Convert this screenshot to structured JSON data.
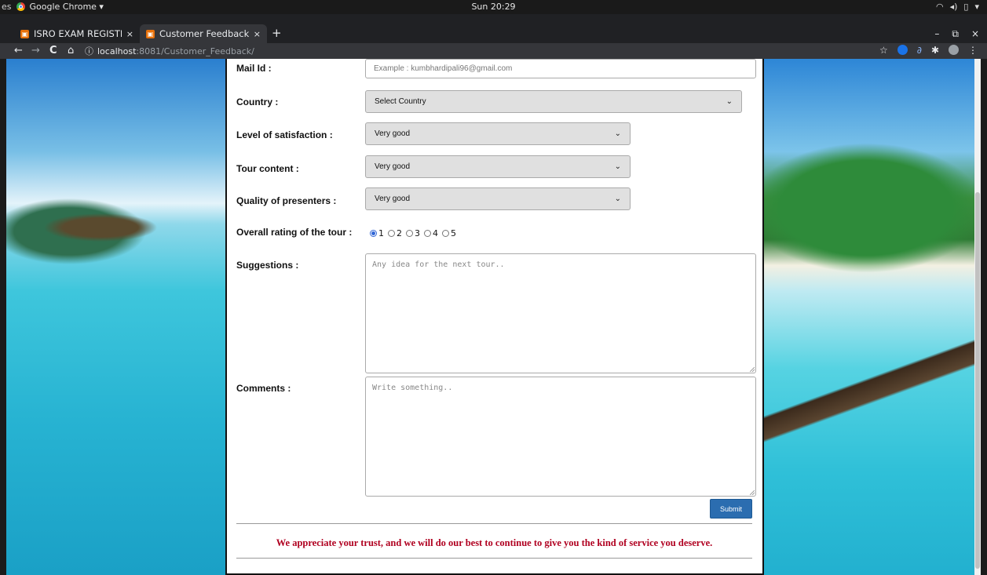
{
  "os_bar": {
    "activities": "es",
    "app_menu": "Google Chrome ▾",
    "clock": "Sun 20:29",
    "tray": [
      "wifi-icon",
      "volume-icon",
      "battery-icon",
      "menu-arrow-icon"
    ]
  },
  "browser": {
    "tabs": [
      {
        "title": "ISRO EXAM REGISTRATIO",
        "close": "×",
        "active": false
      },
      {
        "title": "Customer Feedback Form",
        "close": "×",
        "active": true
      }
    ],
    "new_tab": "+",
    "window_controls": {
      "minimize": "–",
      "restore": "⧉",
      "close": "×"
    },
    "nav": {
      "back": "←",
      "forward": "→",
      "reload": "C",
      "home": "⌂"
    },
    "url": {
      "host": "localhost",
      "path": ":8081/Customer_Feedback/"
    },
    "toolbar_icons": [
      "star-icon",
      "extension-icon",
      "link-icon",
      "puzzle-icon",
      "avatar-icon",
      "menu-icon"
    ]
  },
  "form": {
    "mail": {
      "label": "Mail Id :",
      "placeholder": "Example : kumbhardipali96@gmail.com"
    },
    "country": {
      "label": "Country :",
      "value": "Select Country"
    },
    "satisfaction": {
      "label": "Level of satisfaction :",
      "value": "Very good"
    },
    "tour_content": {
      "label": "Tour content :",
      "value": "Very good"
    },
    "presenters": {
      "label": "Quality of presenters :",
      "value": "Very good"
    },
    "rating": {
      "label": "Overall rating of the tour :",
      "options": [
        "1",
        "2",
        "3",
        "4",
        "5"
      ],
      "selected": "1"
    },
    "suggestions": {
      "label": "Suggestions :",
      "placeholder": "Any idea for the next tour.."
    },
    "comments": {
      "label": "Comments :",
      "placeholder": "Write something.."
    },
    "submit": "Submit"
  },
  "footer": {
    "message": "We appreciate your trust, and we will do our best to continue to give you the kind of service you deserve."
  },
  "colors": {
    "accent_button": "#2b6db0",
    "thanks_text": "#b00020",
    "radio_selected": "#3367d6"
  }
}
